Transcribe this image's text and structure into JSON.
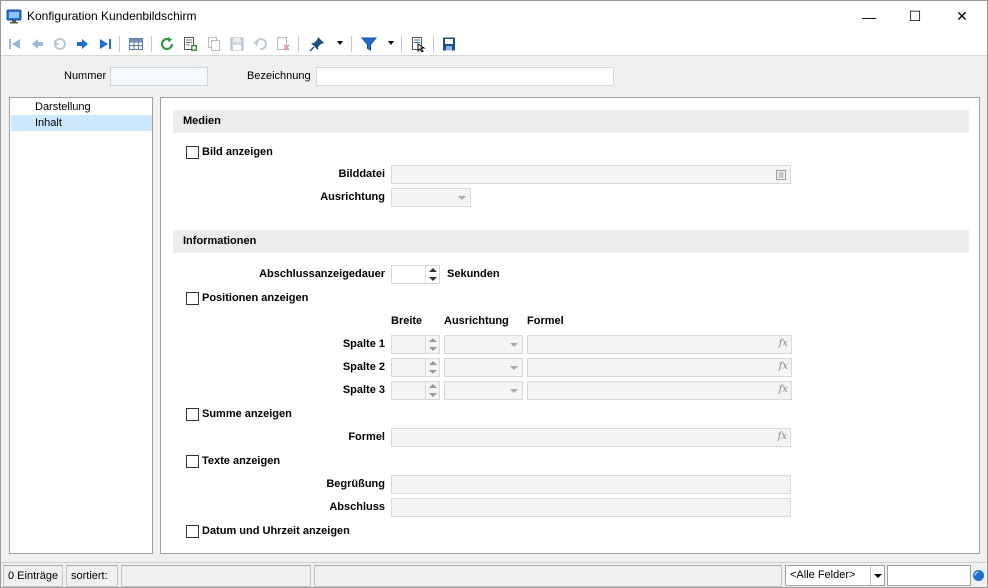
{
  "window": {
    "title": "Konfiguration Kundenbildschirm",
    "minimize_glyph": "—",
    "maximize_glyph": "☐",
    "close_glyph": "✕"
  },
  "toolbar": {
    "icons": [
      "first-record-icon",
      "prev-record-icon",
      "back-icon",
      "next-record-icon",
      "last-record-icon",
      "table-view-icon",
      "refresh-icon",
      "new-record-icon",
      "copy-record-icon",
      "save-icon",
      "undo-icon",
      "delete-icon",
      "pin-icon",
      "filter-icon",
      "search-record-icon",
      "save-layout-icon"
    ]
  },
  "header": {
    "nummer_label": "Nummer",
    "nummer_value": "",
    "bezeichnung_label": "Bezeichnung",
    "bezeichnung_value": ""
  },
  "tree": {
    "items": [
      {
        "label": "Darstellung",
        "selected": false
      },
      {
        "label": "Inhalt",
        "selected": true
      }
    ]
  },
  "medien": {
    "section_title": "Medien",
    "bild_anzeigen_label": "Bild anzeigen",
    "bilddatei_label": "Bilddatei",
    "ausrichtung_label": "Ausrichtung"
  },
  "informationen": {
    "section_title": "Informationen",
    "abschluss_label": "Abschlussanzeigedauer",
    "sekunden_label": "Sekunden",
    "positionen_label": "Positionen anzeigen",
    "col_breite": "Breite",
    "col_ausrichtung": "Ausrichtung",
    "col_formel": "Formel",
    "spalten": [
      "Spalte 1",
      "Spalte 2",
      "Spalte 3"
    ],
    "summe_label": "Summe anzeigen",
    "formel_label": "Formel",
    "texte_label": "Texte anzeigen",
    "begruessung_label": "Begrüßung",
    "abschluss_text_label": "Abschluss",
    "datum_label": "Datum und Uhrzeit anzeigen"
  },
  "statusbar": {
    "entries": "0 Einträge",
    "sorted": "sortiert:",
    "field_filter": "<Alle Felder>"
  },
  "colors": {
    "selection": "#cce8ff",
    "section_bg": "#ececec",
    "accent_blue": "#1f6fd1",
    "accent_green": "#2e9a3c"
  }
}
